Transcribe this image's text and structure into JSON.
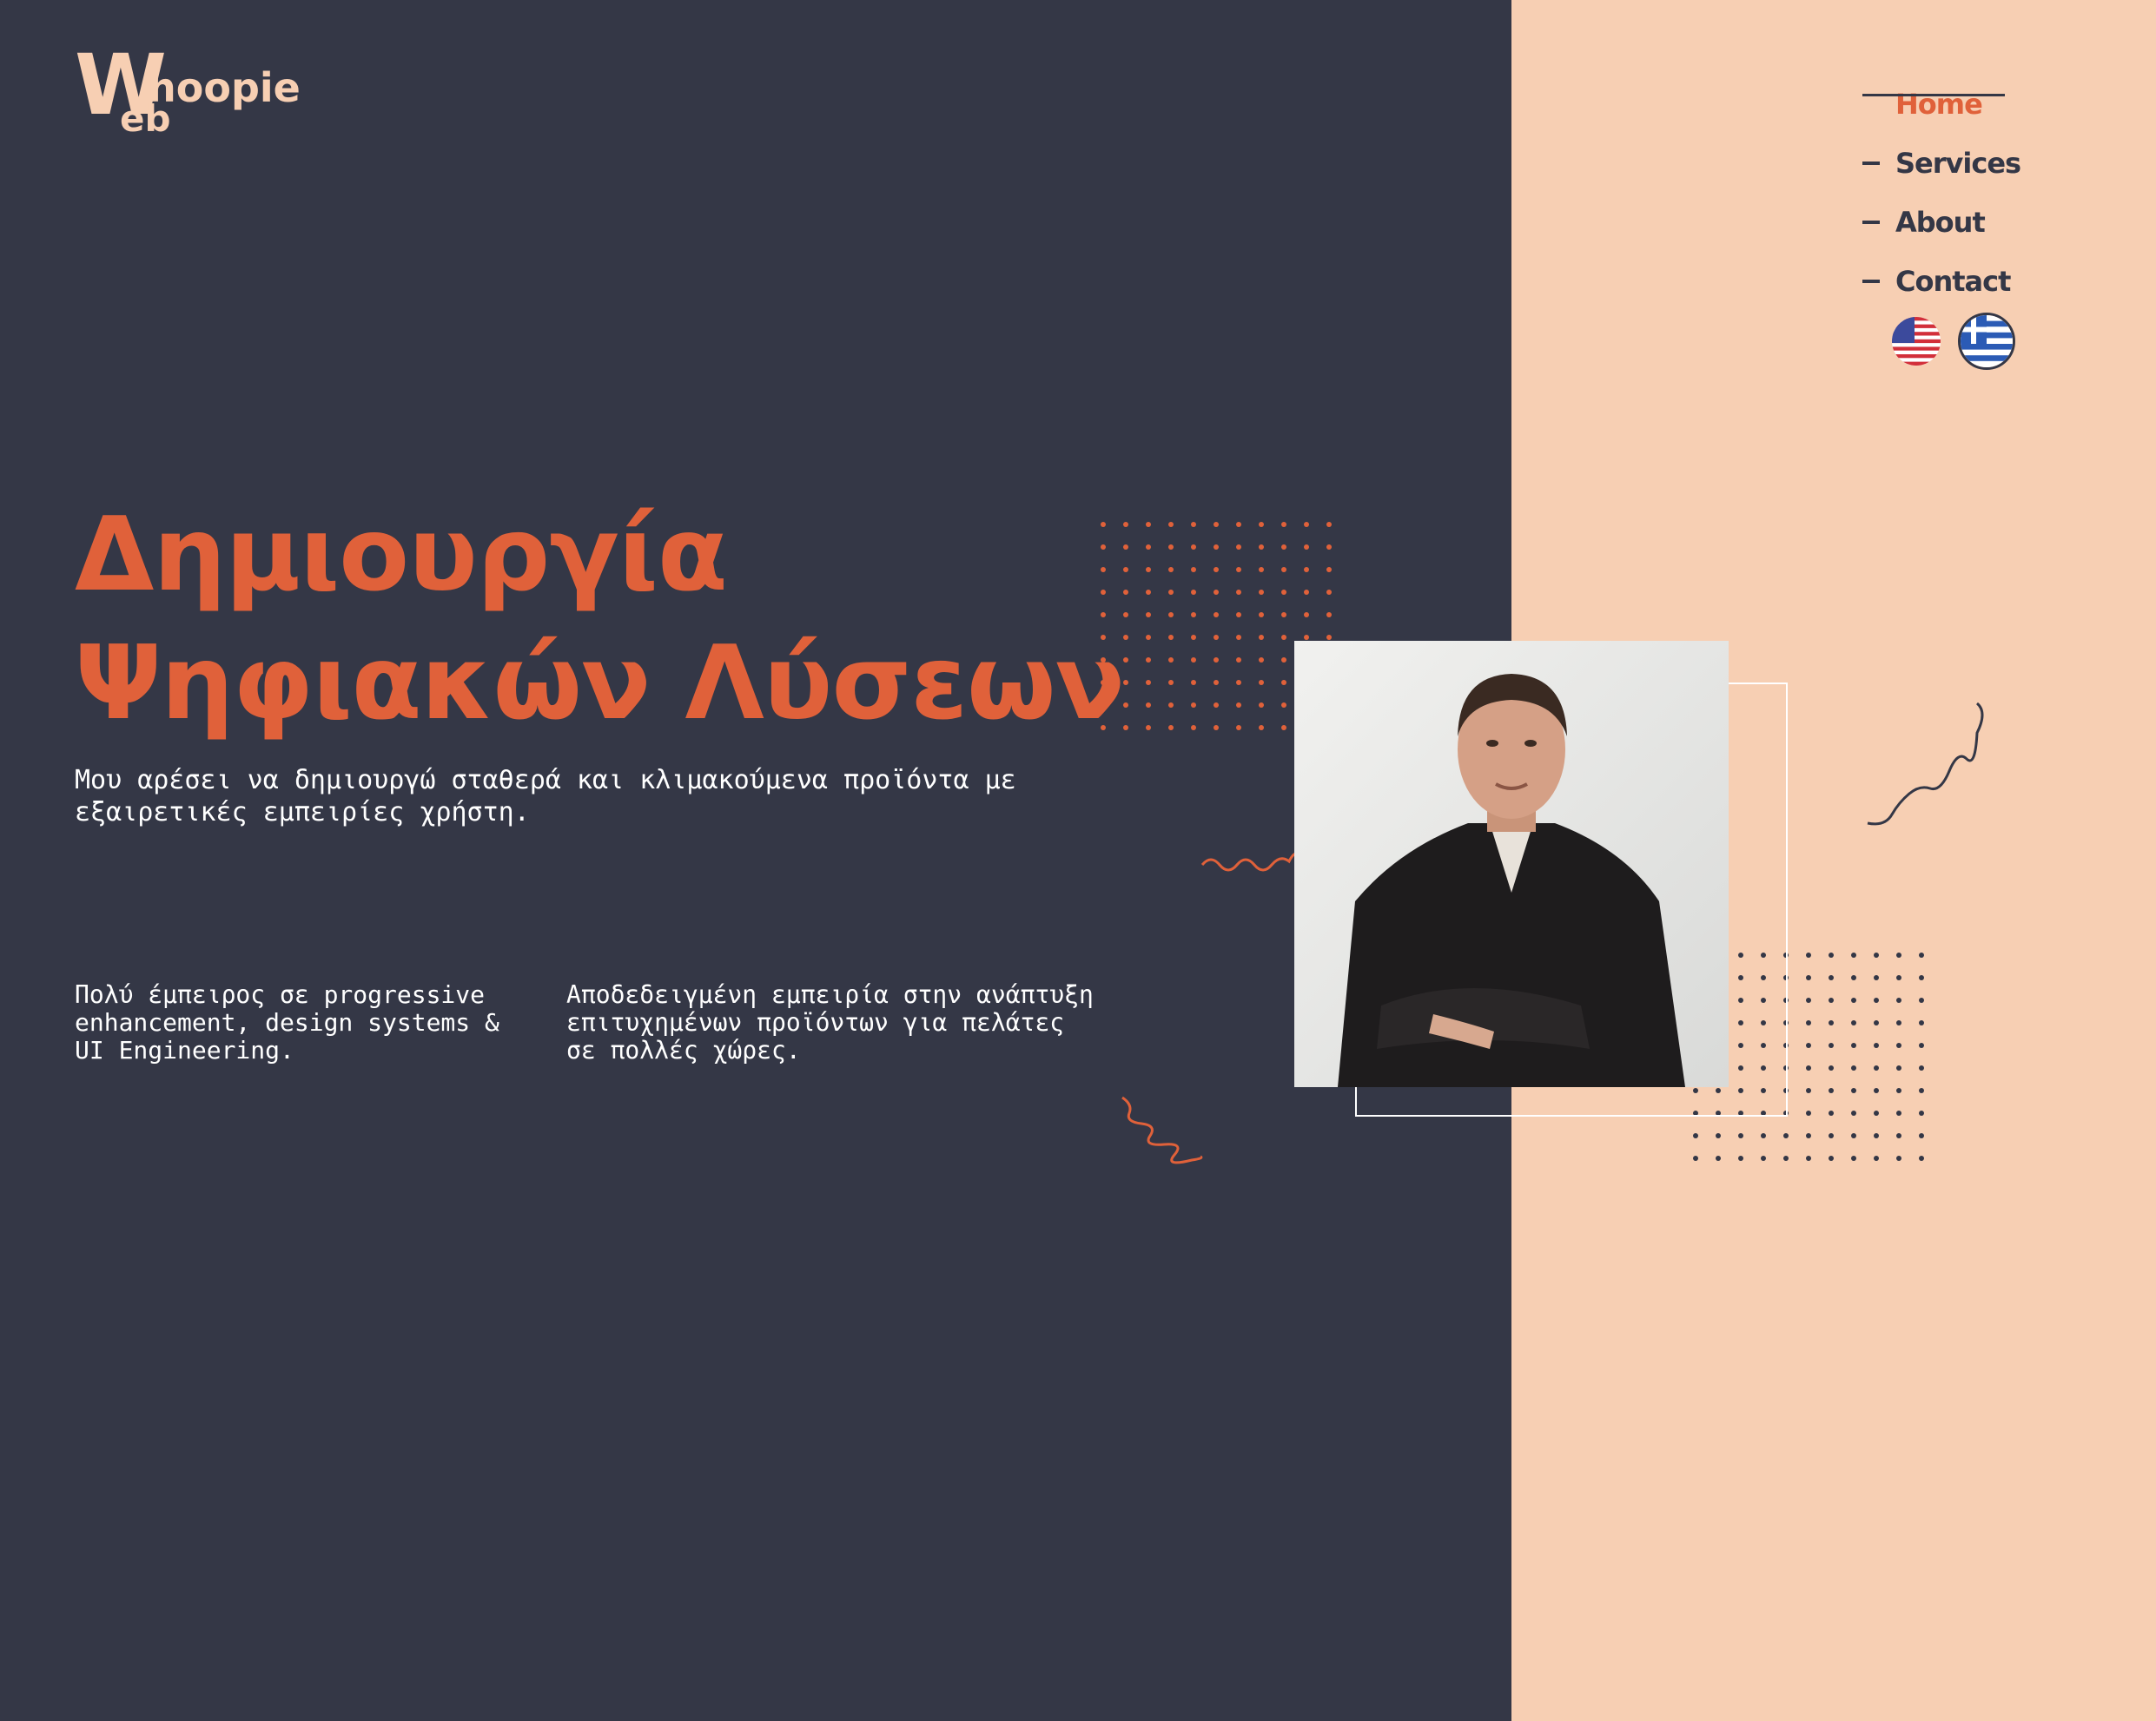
{
  "brand": {
    "logo_main": "W",
    "logo_top": "hoopie",
    "logo_bottom": "eb"
  },
  "nav": {
    "items": [
      {
        "label": "Home",
        "active": true
      },
      {
        "label": "Services",
        "active": false
      },
      {
        "label": "About",
        "active": false
      },
      {
        "label": "Contact",
        "active": false
      }
    ]
  },
  "languages": [
    {
      "icon": "us-flag-icon",
      "code": "en"
    },
    {
      "icon": "greece-flag-icon",
      "code": "el",
      "selected": true
    }
  ],
  "hero": {
    "title_line1": "Δημιουργία",
    "title_line2": "Ψηφιακών Λύσεων",
    "lead": "Μου αρέσει να δημιουργώ σταθερά και κλιμακούμενα προϊόντα με εξαιρετικές εμπειρίες χρήστη.",
    "col1": "Πολύ έμπειρος σε progressive\nenhancement, design systems &\nUI Engineering.",
    "col2": "Αποδεδειγμένη εμπειρία στην ανάπτυξη\nεπιτυχημένων προϊόντων για πελάτες\nσε πολλές χώρες."
  },
  "colors": {
    "dark": "#343746",
    "peach": "#f7cfb3",
    "accent": "#e0613a"
  },
  "portrait": {
    "icon": "portrait-photo"
  }
}
